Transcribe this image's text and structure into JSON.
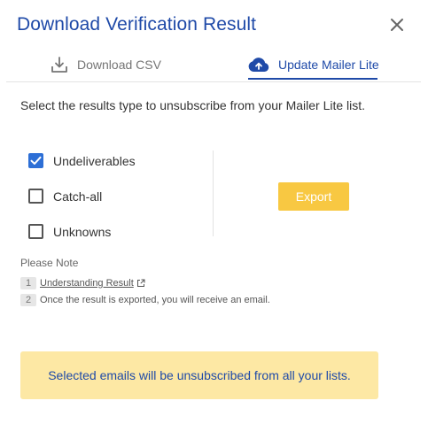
{
  "dialog": {
    "title": "Download Verification Result",
    "close_icon": "close-icon"
  },
  "tabs": [
    {
      "label": "Download CSV",
      "icon": "download-icon",
      "active": false
    },
    {
      "label": "Update Mailer Lite",
      "icon": "cloud-upload-icon",
      "active": true
    }
  ],
  "instruction": "Select the results type to unsubscribe from your Mailer Lite list.",
  "options": [
    {
      "label": "Undeliverables",
      "checked": true
    },
    {
      "label": "Catch-all",
      "checked": false
    },
    {
      "label": "Unknowns",
      "checked": false
    }
  ],
  "export_label": "Export",
  "notes": {
    "title": "Please Note",
    "items": [
      {
        "num": "1",
        "text": "Understanding Result",
        "link": true,
        "icon": "external-link-icon"
      },
      {
        "num": "2",
        "text": "Once the result is exported, you will receive an email."
      }
    ]
  },
  "banner": "Selected emails will be unsubscribed from all your lists.",
  "colors": {
    "primary": "#1f4aa8",
    "checkbox_checked": "#2d6fd6",
    "export_button": "#f8c842",
    "banner_bg": "#fde8a4"
  }
}
